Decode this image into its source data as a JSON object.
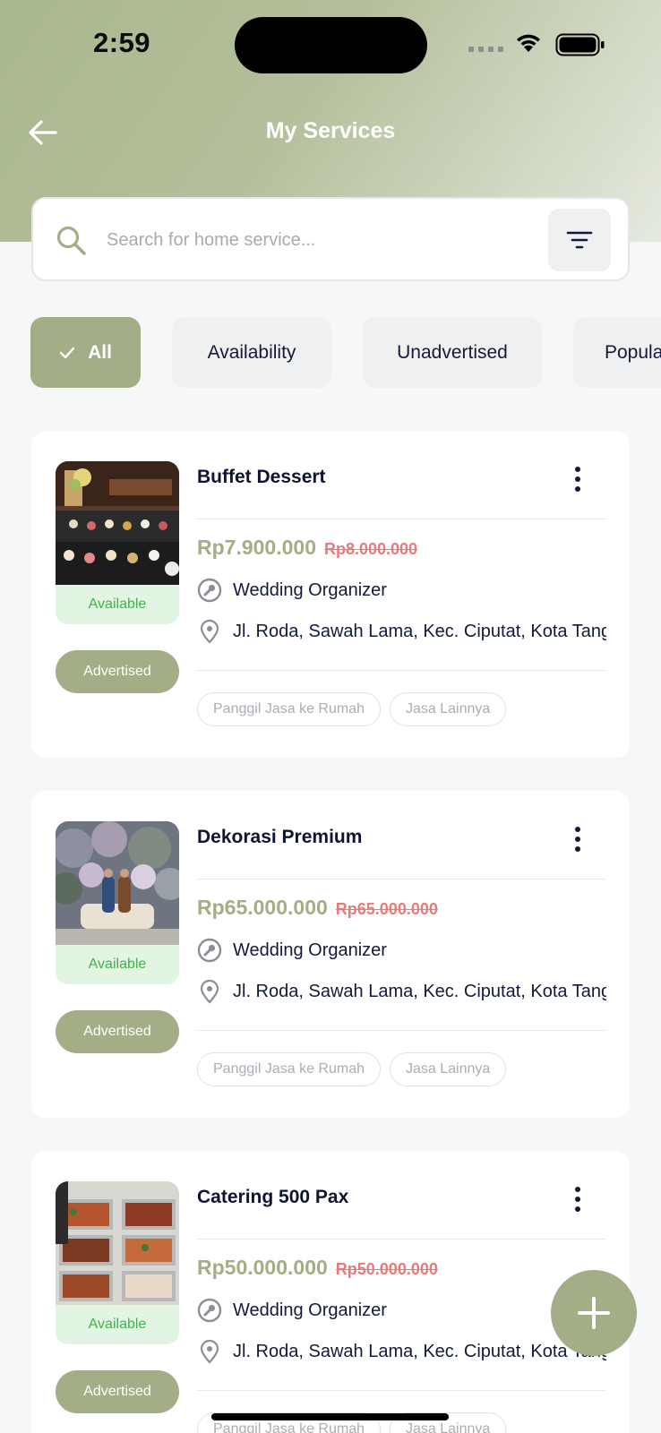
{
  "status_bar": {
    "time": "2:59"
  },
  "header": {
    "title": "My Services"
  },
  "search": {
    "placeholder": "Search for home service..."
  },
  "filters": [
    {
      "label": "All",
      "active": true
    },
    {
      "label": "Availability",
      "active": false
    },
    {
      "label": "Unadvertised",
      "active": false
    },
    {
      "label": "Popular",
      "active": false
    }
  ],
  "services": [
    {
      "title": "Buffet Dessert",
      "status": "Available",
      "ad_label": "Advertised",
      "price": "Rp7.900.000",
      "old_price": "Rp8.000.000",
      "category": "Wedding Organizer",
      "address": "Jl. Roda, Sawah Lama, Kec. Ciputat, Kota Tangerang Selatan",
      "tags": [
        "Panggil Jasa ke Rumah",
        "Jasa Lainnya"
      ]
    },
    {
      "title": "Dekorasi Premium",
      "status": "Available",
      "ad_label": "Advertised",
      "price": "Rp65.000.000",
      "old_price": "Rp65.000.000",
      "category": "Wedding Organizer",
      "address": "Jl. Roda, Sawah Lama, Kec. Ciputat, Kota Tangerang Selatan",
      "tags": [
        "Panggil Jasa ke Rumah",
        "Jasa Lainnya"
      ]
    },
    {
      "title": "Catering 500 Pax",
      "status": "Available",
      "ad_label": "Advertised",
      "price": "Rp50.000.000",
      "old_price": "Rp50.000.000",
      "category": "Wedding Organizer",
      "address": "Jl. Roda, Sawah Lama, Kec. Ciputat, Kota Tangerang Selatan",
      "tags": [
        "Panggil Jasa ke Rumah",
        "Jasa Lainnya"
      ]
    }
  ],
  "colors": {
    "accent": "#a3ae86",
    "available_text": "#40b24a",
    "old_price": "#e87a7a",
    "text_dark": "#111a3a"
  },
  "icons": {
    "back": "arrow-left-icon",
    "search": "search-icon",
    "filter": "filter-icon",
    "check": "check-icon",
    "more": "more-vertical-icon",
    "category": "wrench-icon",
    "location": "location-pin-icon",
    "add": "plus-icon"
  }
}
